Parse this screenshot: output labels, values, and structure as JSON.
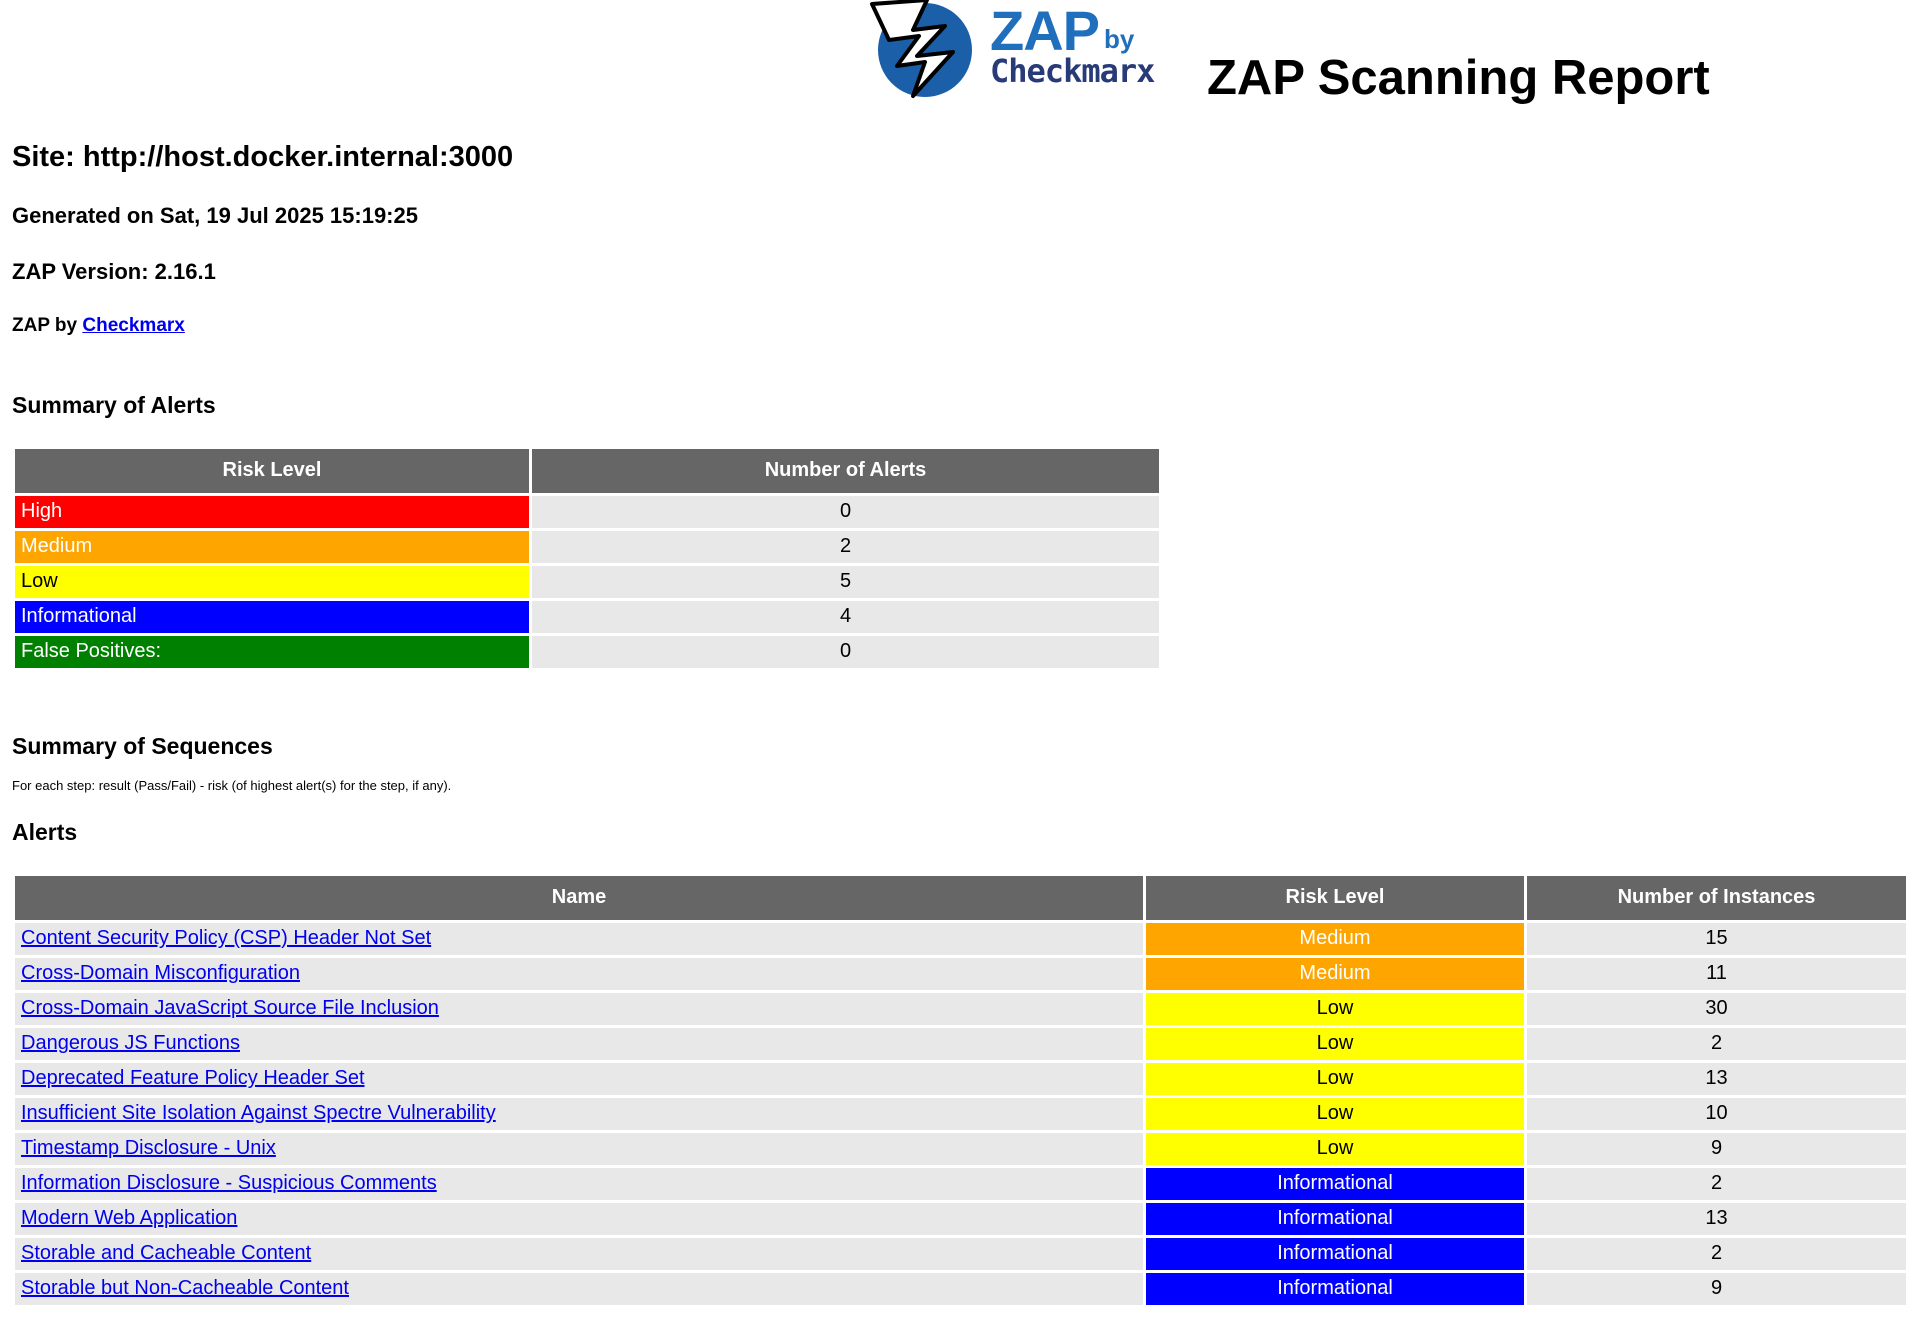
{
  "header": {
    "logo_zap": "ZAP",
    "logo_by": "by",
    "logo_checkmarx": "Checkmarx",
    "title": "ZAP Scanning Report"
  },
  "site": "Site: http://host.docker.internal:3000",
  "generated": "Generated on Sat, 19 Jul 2025 15:19:25",
  "version": "ZAP Version: 2.16.1",
  "zap_by": {
    "prefix": "ZAP by ",
    "link": "Checkmarx"
  },
  "summary_alerts": {
    "title": "Summary of Alerts",
    "headers": [
      "Risk Level",
      "Number of Alerts"
    ],
    "rows": [
      {
        "level": "High",
        "count": "0",
        "color": "#ff0000"
      },
      {
        "level": "Medium",
        "count": "2",
        "color": "#ffa500"
      },
      {
        "level": "Low",
        "count": "5",
        "color": "#ffff00"
      },
      {
        "level": "Informational",
        "count": "4",
        "color": "#0000ff"
      },
      {
        "level": "False Positives:",
        "count": "0",
        "color": "#008000"
      }
    ]
  },
  "summary_sequences": {
    "title": "Summary of Sequences",
    "note": "For each step: result (Pass/Fail) - risk (of highest alert(s) for the step, if any)."
  },
  "alerts": {
    "title": "Alerts",
    "headers": [
      "Name",
      "Risk Level",
      "Number of Instances"
    ],
    "rows": [
      {
        "name": "Content Security Policy (CSP) Header Not Set",
        "risk": "Medium",
        "instances": "15"
      },
      {
        "name": "Cross-Domain Misconfiguration",
        "risk": "Medium",
        "instances": "11"
      },
      {
        "name": "Cross-Domain JavaScript Source File Inclusion",
        "risk": "Low",
        "instances": "30"
      },
      {
        "name": "Dangerous JS Functions",
        "risk": "Low",
        "instances": "2"
      },
      {
        "name": "Deprecated Feature Policy Header Set",
        "risk": "Low",
        "instances": "13"
      },
      {
        "name": "Insufficient Site Isolation Against Spectre Vulnerability",
        "risk": "Low",
        "instances": "10"
      },
      {
        "name": "Timestamp Disclosure - Unix",
        "risk": "Low",
        "instances": "9"
      },
      {
        "name": "Information Disclosure - Suspicious Comments",
        "risk": "Informational",
        "instances": "2"
      },
      {
        "name": "Modern Web Application",
        "risk": "Informational",
        "instances": "13"
      },
      {
        "name": "Storable and Cacheable Content",
        "risk": "Informational",
        "instances": "2"
      },
      {
        "name": "Storable but Non-Cacheable Content",
        "risk": "Informational",
        "instances": "9"
      }
    ]
  }
}
